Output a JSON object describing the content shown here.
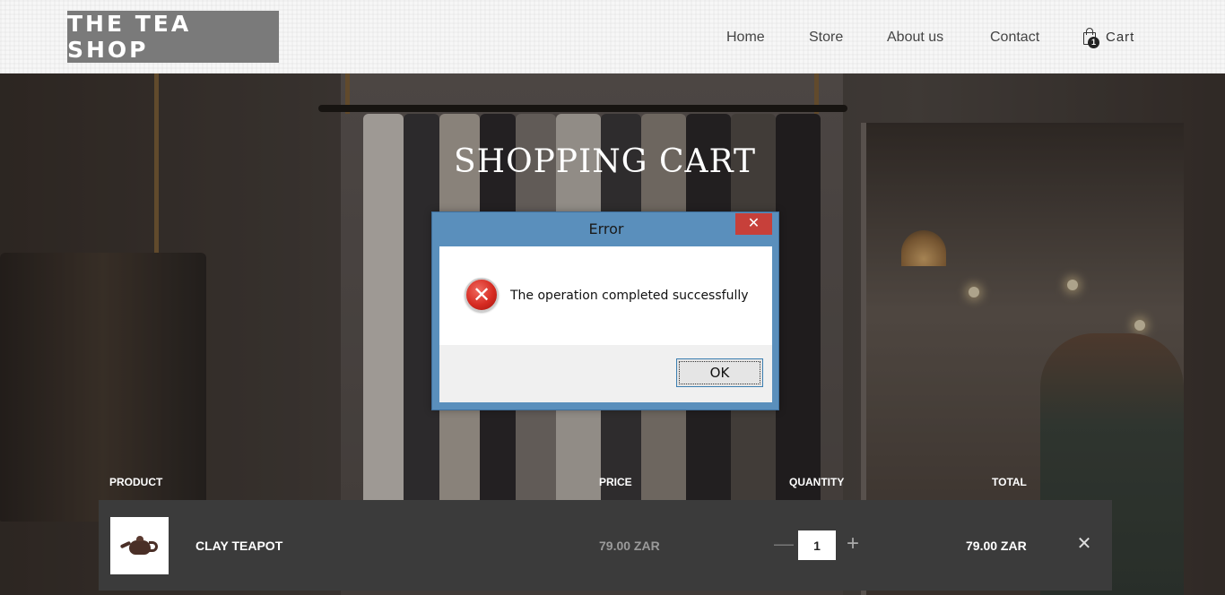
{
  "header": {
    "logo": "THE TEA SHOP",
    "nav": [
      {
        "label": "Home"
      },
      {
        "label": "Store"
      },
      {
        "label": "About us"
      },
      {
        "label": "Contact"
      }
    ],
    "cart": {
      "label": "Cart",
      "count": "1",
      "icon": "shopping-bag-icon"
    }
  },
  "page": {
    "title": "SHOPPING CART"
  },
  "table": {
    "headers": {
      "product": "PRODUCT",
      "price": "PRICE",
      "quantity": "QUANTITY",
      "total": "TOTAL"
    },
    "rows": [
      {
        "name": "CLAY TEAPOT",
        "price": "79.00 ZAR",
        "quantity": "1",
        "total": "79.00 ZAR",
        "image": "clay-teapot-image"
      }
    ],
    "controls": {
      "minus": "—",
      "plus": "+",
      "remove": "✕"
    }
  },
  "dialog": {
    "title": "Error",
    "close": "✕",
    "icon": "error-icon",
    "message": "The operation completed successfully",
    "ok_label": "OK"
  },
  "colors": {
    "dialog_frame": "#5a8fbc",
    "close_button": "#c7403a",
    "logo_bg": "#7a7a7a",
    "cart_row_bg": "#3b3b3b"
  }
}
